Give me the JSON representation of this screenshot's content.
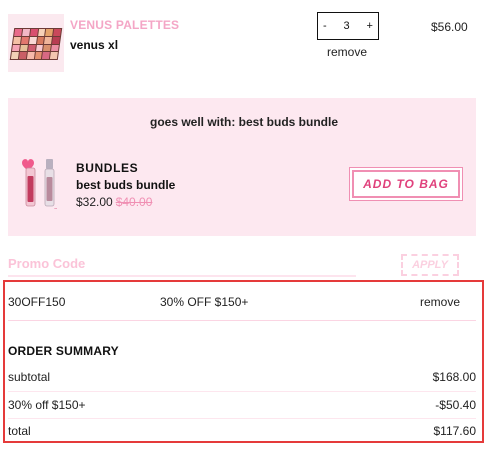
{
  "cart_item": {
    "brand": "VENUS PALETTES",
    "name": "venus xl",
    "quantity": "3",
    "minus_label": "-",
    "plus_label": "+",
    "remove_label": "remove",
    "price": "$56.00"
  },
  "upsell": {
    "title": "goes well with: best buds bundle",
    "category": "BUNDLES",
    "name": "best buds bundle",
    "price": "$32.00",
    "old_price": "$40.00",
    "button_label": "ADD TO BAG"
  },
  "promo": {
    "label": "Promo Code",
    "apply_label": "APPLY",
    "applied_code": "30OFF150",
    "applied_description": "30% OFF $150+",
    "remove_label": "remove"
  },
  "order_summary": {
    "title": "ORDER SUMMARY",
    "subtotal_label": "subtotal",
    "subtotal_value": "$168.00",
    "discount_label": "30% off $150+",
    "discount_value": "-$50.40",
    "total_label": "total",
    "total_value": "$117.60"
  },
  "colors": {
    "accent_pink": "#f4a6c6",
    "upsell_bg": "#fde8f0",
    "button_text": "#e0417c",
    "highlight_border": "#e53a3a"
  }
}
